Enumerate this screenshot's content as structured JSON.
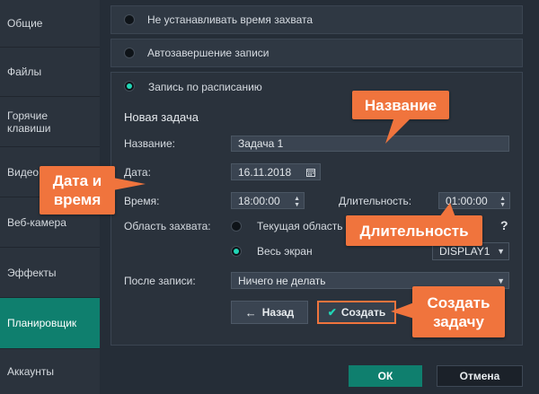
{
  "sidebar": {
    "items": [
      {
        "label": "Общие"
      },
      {
        "label": "Файлы"
      },
      {
        "label": "Горячие клавиши"
      },
      {
        "label": "Видео"
      },
      {
        "label": "Веб-камера"
      },
      {
        "label": "Эффекты"
      },
      {
        "label": "Планировщик"
      },
      {
        "label": "Аккаунты"
      }
    ],
    "active": "Планировщик"
  },
  "options": {
    "no_time": "Не устанавливать время захвата",
    "auto_end": "Автозавершение записи",
    "scheduled": "Запись по расписанию"
  },
  "task": {
    "heading": "Новая задача",
    "name_label": "Название:",
    "name_value": "Задача 1",
    "date_label": "Дата:",
    "date_value": "16.11.2018",
    "time_label": "Время:",
    "time_value": "18:00:00",
    "duration_label": "Длительность:",
    "duration_value": "01:00:00",
    "area_label": "Область захвата:",
    "area_current": "Текущая область",
    "area_full": "Весь экран",
    "display_value": "DISPLAY1",
    "help": "?",
    "after_label": "После записи:",
    "after_value": "Ничего не делать",
    "back_button": "Назад",
    "create_button": "Создать"
  },
  "footer": {
    "ok": "ОК",
    "cancel": "Отмена"
  },
  "callouts": {
    "name": "Название",
    "datetime": "Дата и время",
    "duration": "Длительность",
    "create": "Создать задачу"
  },
  "colors": {
    "accent": "#0f7f6e",
    "callout": "#f0743d",
    "radio_on": "#21d6b6"
  }
}
